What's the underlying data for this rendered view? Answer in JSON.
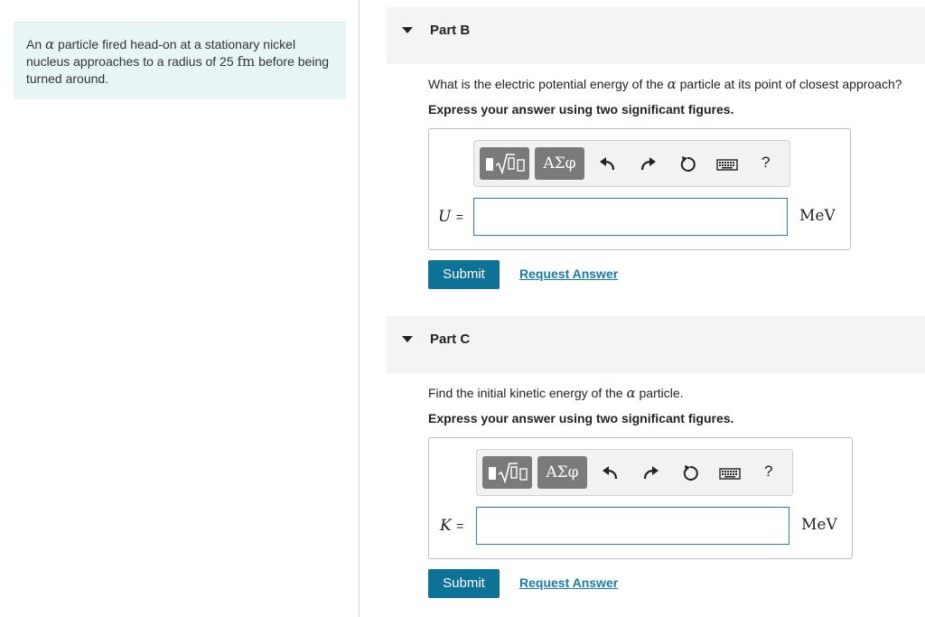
{
  "problem": {
    "text_before_alpha": "An ",
    "alpha_symbol": "α",
    "text_after_alpha": " particle fired head-on at a stationary nickel nucleus approaches to a radius of 25 ",
    "radius_unit": "fm",
    "text_end": " before being turned around."
  },
  "parts": [
    {
      "title": "Part B",
      "question_before": "What is the electric potential energy of the ",
      "question_symbol": "α",
      "question_after": " particle at its point of closest approach?",
      "instruction": "Express your answer using two significant figures.",
      "toolbar": {
        "greek_label": "ΑΣφ",
        "help_label": "?"
      },
      "variable": "U",
      "equals": "=",
      "input_value": "",
      "unit": "MeV",
      "submit_label": "Submit",
      "request_label": "Request Answer"
    },
    {
      "title": "Part C",
      "question_before": "Find the initial kinetic energy of the ",
      "question_symbol": "α",
      "question_after": " particle.",
      "instruction": "Express your answer using two significant figures.",
      "toolbar": {
        "greek_label": "ΑΣφ",
        "help_label": "?"
      },
      "variable": "K",
      "equals": "=",
      "input_value": "",
      "unit": "MeV",
      "submit_label": "Submit",
      "request_label": "Request Answer"
    }
  ],
  "icons": [
    "radical-template-icon",
    "greek-letters-icon",
    "undo-icon",
    "redo-icon",
    "reset-icon",
    "keyboard-icon",
    "help-icon"
  ]
}
